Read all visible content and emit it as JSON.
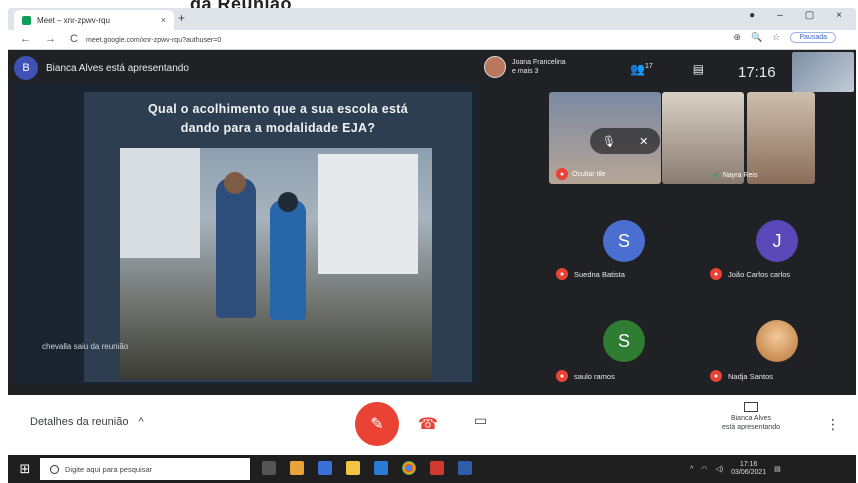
{
  "heading_fragment": "da Reunião",
  "browser": {
    "tab_title": "Meet – xnr-zpwv-rqu",
    "tab_close": "×",
    "new_tab": "+",
    "window_controls": [
      "●",
      "–",
      "▢",
      "×"
    ],
    "nav_icons": [
      "←",
      "→",
      "C"
    ],
    "url": "meet.google.com/xnr-zpwv-rqu?authuser=0",
    "right_icons": [
      "⊕",
      "🔍",
      "☆"
    ],
    "profile_label": "Pausada"
  },
  "meet": {
    "presenter_initial": "B",
    "presenter_text": "Bianca Alves está apresentando",
    "pinned_name": "Joana Francelina",
    "pinned_more": "e mais 3",
    "people_count": "17",
    "clock": "17:16",
    "slide": {
      "title_line1": "Qual o acolhimento que a sua escola está",
      "title_line2": "dando para a modalidade EJA?",
      "caption": "chevalla saiu da reunião"
    },
    "tiles": {
      "tile1_label": "Ocultar tile",
      "tile3_label": "Nayra Reis"
    },
    "participants": [
      {
        "initial": "S",
        "name": "Suedna Batista",
        "color": "#4a6fd1"
      },
      {
        "initial": "J",
        "name": "João Carlos carlos",
        "color": "#5a48b8"
      },
      {
        "initial": "S",
        "name": "saulo ramos",
        "color": "#2e7d32"
      },
      {
        "initial": "",
        "name": "Nadja Santos",
        "color": "#c98a3b"
      }
    ]
  },
  "controls": {
    "meeting_details": "Detalhes da reunião",
    "chevron": "^",
    "present_line1": "Bianca Alves",
    "present_line2": "está apresentando",
    "more": "⋮"
  },
  "taskbar": {
    "start": "⊞",
    "search_placeholder": "Digite aqui para pesquisar",
    "tray_time": "17:16",
    "tray_date": "03/06/2021"
  }
}
